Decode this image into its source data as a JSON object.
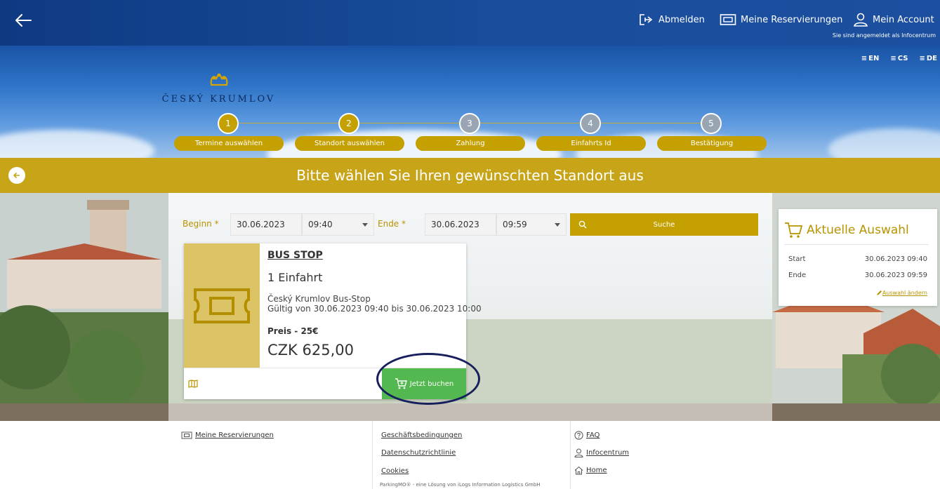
{
  "topbar": {
    "logout": "Abmelden",
    "reservations": "Meine Reservierungen",
    "account": "Mein Account",
    "logged_in_text": "Sie sind angemeldet als Infocentrum"
  },
  "languages": [
    "EN",
    "CS",
    "DE"
  ],
  "logo": {
    "name": "ČESKÝ KRUMLOV"
  },
  "steps": [
    {
      "number": "1",
      "label": "Termine auswählen",
      "state": "done"
    },
    {
      "number": "2",
      "label": "Standort auswählen",
      "state": "active"
    },
    {
      "number": "3",
      "label": "Zahlung",
      "state": "pending"
    },
    {
      "number": "4",
      "label": "Einfahrts Id",
      "state": "pending"
    },
    {
      "number": "5",
      "label": "Bestätigung",
      "state": "pending"
    }
  ],
  "banner": {
    "title": "Bitte wählen Sie Ihren gewünschten Standort aus"
  },
  "search": {
    "start_label": "Beginn *",
    "start_date": "30.06.2023",
    "start_time": "09:40",
    "end_label": "Ende *",
    "end_date": "30.06.2023",
    "end_time": "09:59",
    "button_label": "Suche"
  },
  "product": {
    "title": "BUS STOP",
    "count": "1 Einfahrt",
    "location": "Český Krumlov Bus-Stop",
    "validity": "Gültig von 30.06.2023 09:40 bis 30.06.2023 10:00",
    "price_label": "Preis - 25€",
    "price": "CZK 625,00",
    "book_label": "Jetzt buchen"
  },
  "summary": {
    "title": "Aktuelle Auswahl",
    "start_label": "Start",
    "start_value": "30.06.2023 09:40",
    "end_label": "Ende",
    "end_value": "30.06.2023 09:59",
    "change_label": "Auswahl ändern"
  },
  "footer": {
    "reservations": "Meine Reservierungen",
    "terms": "Geschäftsbedingungen",
    "privacy": "Datenschutzrichtlinie",
    "cookies": "Cookies",
    "faq": "FAQ",
    "infocentrum": "Infocentrum",
    "home": "Home",
    "copyright": "ParkingMO® - eine Lösung von iLogs Information Logistics GmbH"
  },
  "colors": {
    "brand_gold": "#c4a000",
    "topbar_blue": "#0e3a82",
    "book_green": "#52b84f",
    "highlight_navy": "#17205c"
  }
}
